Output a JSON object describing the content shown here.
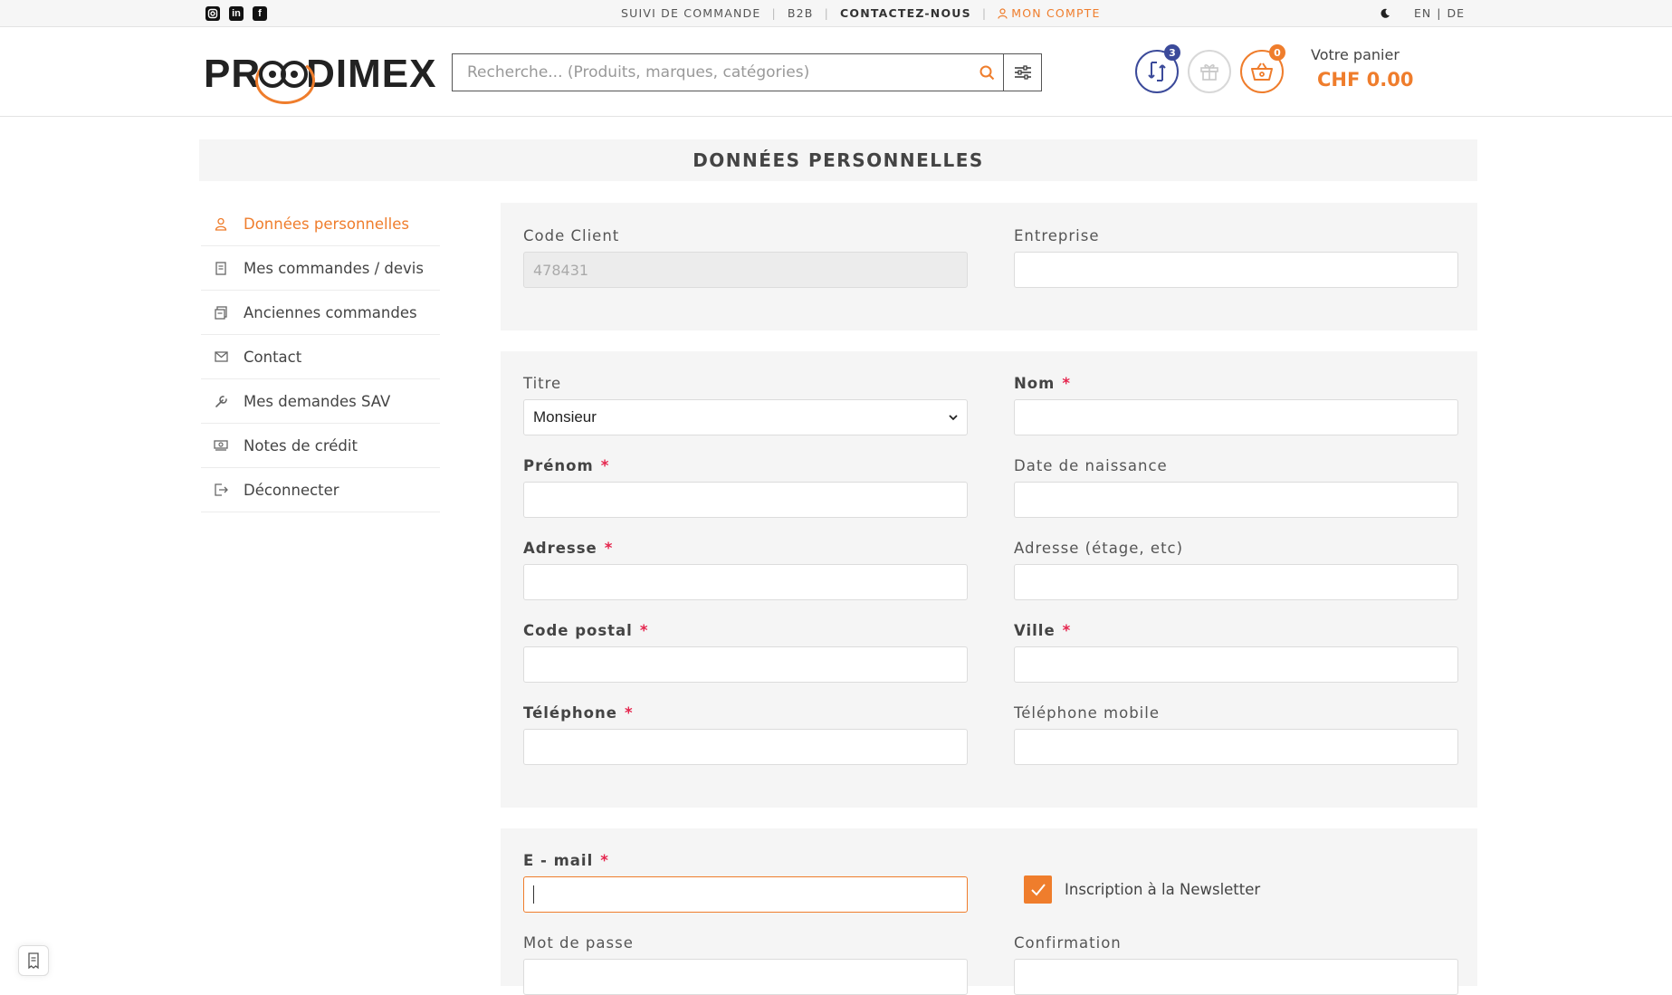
{
  "colors": {
    "accent": "#ef7d2c",
    "compare": "#3b4a9a",
    "required": "#e5254d"
  },
  "topbar": {
    "social_icons": [
      "instagram-icon",
      "linkedin-icon",
      "facebook-icon"
    ],
    "nav": {
      "order_tracking": "SUIVI DE COMMANDE",
      "b2b": "B2B",
      "contact": "CONTACTEZ-NOUS",
      "account": "MON COMPTE"
    },
    "lang_en": "EN",
    "lang_sep": "|",
    "lang_de": "DE"
  },
  "header": {
    "logo_pre": "PR",
    "logo_post": "DIMEX",
    "search_placeholder": "Recherche... (Produits, marques, catégories)",
    "compare_count": "3",
    "basket_count": "0",
    "cart_label": "Votre panier",
    "cart_total": "CHF 0.00"
  },
  "page_title": "DONNÉES PERSONNELLES",
  "sidebar": {
    "items": [
      {
        "label": "Données personnelles",
        "icon": "user-icon"
      },
      {
        "label": "Mes commandes / devis",
        "icon": "document-icon"
      },
      {
        "label": "Anciennes commandes",
        "icon": "archive-icon"
      },
      {
        "label": "Contact",
        "icon": "envelope-icon"
      },
      {
        "label": "Mes demandes SAV",
        "icon": "wrench-icon"
      },
      {
        "label": "Notes de crédit",
        "icon": "money-icon"
      },
      {
        "label": "Déconnecter",
        "icon": "logout-icon"
      }
    ]
  },
  "form": {
    "code_client_label": "Code Client",
    "code_client_value": "478431",
    "entreprise_label": "Entreprise",
    "titre_label": "Titre",
    "titre_value": "Monsieur",
    "nom_label": "Nom",
    "prenom_label": "Prénom",
    "date_naissance_label": "Date de naissance",
    "adresse_label": "Adresse",
    "adresse2_label": "Adresse (étage, etc)",
    "code_postal_label": "Code postal",
    "ville_label": "Ville",
    "telephone_label": "Téléphone",
    "telephone_mobile_label": "Téléphone mobile",
    "email_label": "E - mail",
    "newsletter_label": "Inscription à la Newsletter",
    "password_label": "Mot de passe",
    "confirmation_label": "Confirmation",
    "required_mark": "*"
  }
}
